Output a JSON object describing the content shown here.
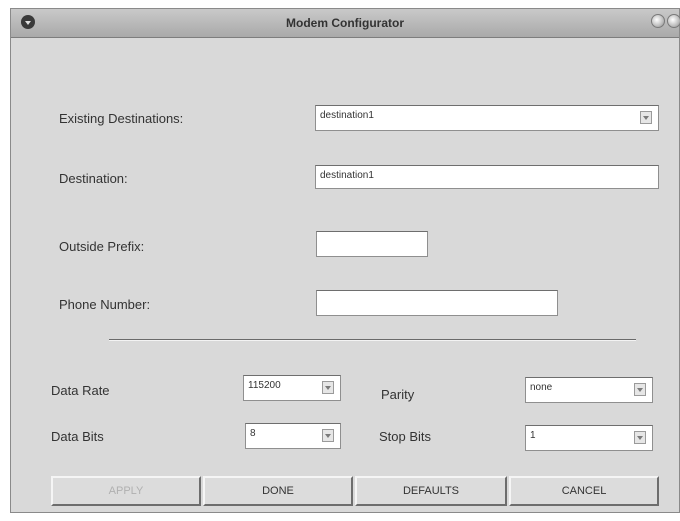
{
  "window": {
    "title": "Modem Configurator"
  },
  "form": {
    "existing_destinations": {
      "label": "Existing Destinations:",
      "value": "destination1"
    },
    "destination": {
      "label": "Destination:",
      "value": "destination1"
    },
    "outside_prefix": {
      "label": "Outside Prefix:",
      "value": ""
    },
    "phone_number": {
      "label": "Phone Number:",
      "value": ""
    }
  },
  "settings": {
    "data_rate": {
      "label": "Data Rate",
      "value": "115200"
    },
    "parity": {
      "label": "Parity",
      "value": "none"
    },
    "data_bits": {
      "label": "Data Bits",
      "value": "8"
    },
    "stop_bits": {
      "label": "Stop Bits",
      "value": "1"
    }
  },
  "buttons": {
    "apply": "APPLY",
    "done": "DONE",
    "defaults": "DEFAULTS",
    "cancel": "CANCEL"
  }
}
